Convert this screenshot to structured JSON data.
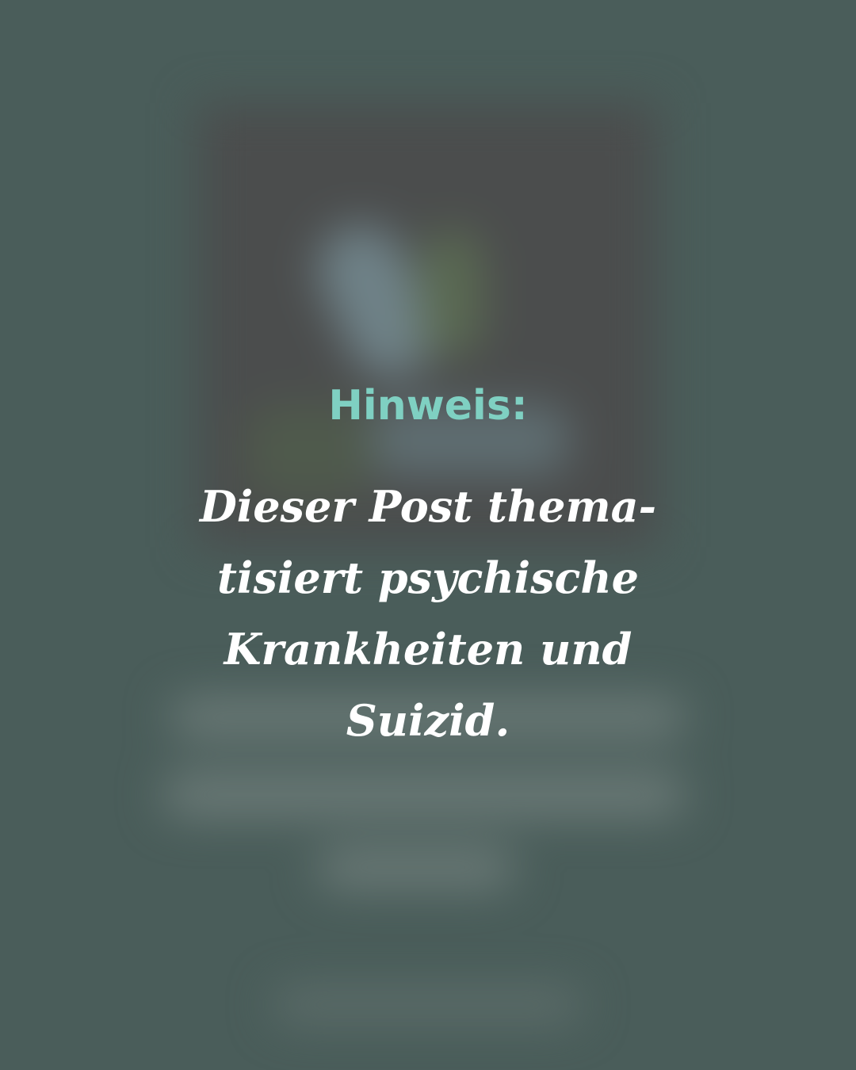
{
  "warning": {
    "title": "Hinweis:",
    "body_lines": [
      "Dieser Post thema-",
      "tisiert  psychische",
      "Krankheiten und",
      "Suizid."
    ]
  },
  "colors": {
    "background": "#4a5d5a",
    "title": "#7fd0c2",
    "body_text": "#ffffff"
  }
}
